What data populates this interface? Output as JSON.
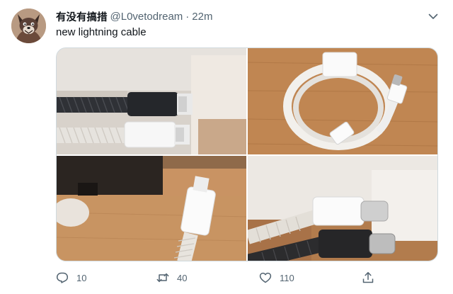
{
  "tweet": {
    "author": {
      "display_name": "有没有搞措",
      "handle": "@L0vetodream",
      "avatar_icon": "wolf-avatar"
    },
    "separator": "·",
    "time": "22m",
    "text": "new lightning cable",
    "menu_icon": "chevron-down-icon",
    "media": [
      {
        "subject": "braided-black-and-white-lightning-connectors"
      },
      {
        "subject": "coiled-braided-cable-usb-c"
      },
      {
        "subject": "white-lightning-connector-braided-cable"
      },
      {
        "subject": "usb-c-connectors-white-and-black"
      }
    ],
    "actions": {
      "reply": {
        "icon": "reply-icon",
        "count": "10"
      },
      "retweet": {
        "icon": "retweet-icon",
        "count": "40"
      },
      "like": {
        "icon": "heart-icon",
        "count": "110"
      },
      "share": {
        "icon": "share-icon"
      }
    },
    "colors": {
      "text": "#0f1419",
      "secondary": "#536471",
      "border": "#cfd9de"
    }
  }
}
